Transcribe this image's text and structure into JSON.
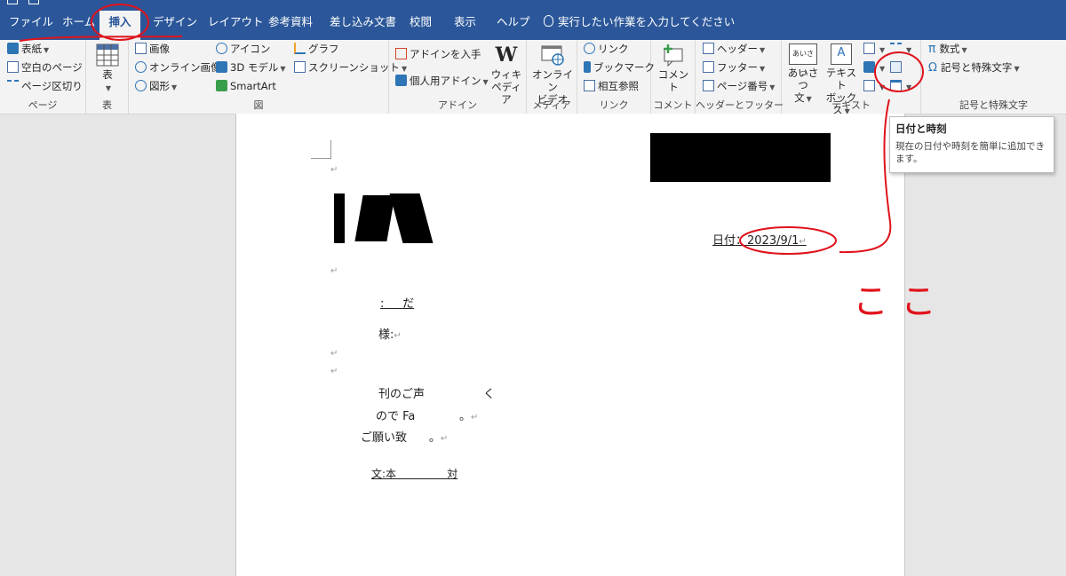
{
  "tabs": [
    {
      "label": "ファイル"
    },
    {
      "label": "ホーム"
    },
    {
      "label": "挿入"
    },
    {
      "label": "デザイン"
    },
    {
      "label": "レイアウト"
    },
    {
      "label": "参考資料"
    },
    {
      "label": "差し込み文書"
    },
    {
      "label": "校閲"
    },
    {
      "label": "表示"
    },
    {
      "label": "ヘルプ"
    }
  ],
  "active_tab": "挿入",
  "tell_me": "実行したい作業を入力してください",
  "ribbon": {
    "pages": {
      "cover": "表紙",
      "blank": "空白のページ",
      "break": "ページ区切り",
      "label": "ページ"
    },
    "table": {
      "table": "表",
      "label": "表"
    },
    "illustrations": {
      "pictures": "画像",
      "online_pictures": "オンライン画像",
      "shapes": "図形",
      "icons": "アイコン",
      "models_3d": "3D モデル",
      "smartart": "SmartArt",
      "chart": "グラフ",
      "screenshot": "スクリーンショット",
      "label": "図"
    },
    "addins": {
      "get": "アドインを入手",
      "my": "個人用アドイン",
      "wiki_1": "ウィキ",
      "wiki_2": "ペディア",
      "label": "アドイン",
      "wiki_glyph": "W"
    },
    "media": {
      "video_1": "オンライン",
      "video_2": "ビデオ",
      "label": "メディア"
    },
    "links": {
      "link": "リンク",
      "bookmark": "ブックマーク",
      "crossref": "相互参照",
      "label": "リンク"
    },
    "comments": {
      "comment": "コメント",
      "label": "コメント"
    },
    "header_footer": {
      "header": "ヘッダー",
      "footer": "フッター",
      "page_number": "ページ番号",
      "label": "ヘッダーとフッター"
    },
    "text": {
      "greeting_1": "あいさつ",
      "greeting_2": "文",
      "textbox_1": "テキスト",
      "textbox_2": "ボックス",
      "greeting_icon": "あいさつ",
      "textbox_icon": "A",
      "label": "テキスト"
    },
    "symbols": {
      "equation": "数式",
      "symbol": "記号と特殊文字",
      "label": "記号と特殊文字",
      "pi": "π",
      "omega": "Ω"
    }
  },
  "tooltip": {
    "title": "日付と時刻",
    "body": "現在の日付や時刻を簡単に追加できます。"
  },
  "document": {
    "date_label": "日付",
    "date_value": "2023/9/1",
    "line_1": ":",
    "line_1b": "だ",
    "line_2": "様:",
    "line_3": "刊のご声",
    "line_3b": "く",
    "line_4": "ので Fa",
    "line_4b": "。",
    "line_5": "ご願い致",
    "line_5b": "。",
    "line_6": "文:本",
    "line_6b": "対"
  },
  "annotation": {
    "note": "ここ"
  },
  "colors": {
    "ribbon_blue": "#2b579a",
    "annotation_red": "#e0121b"
  }
}
